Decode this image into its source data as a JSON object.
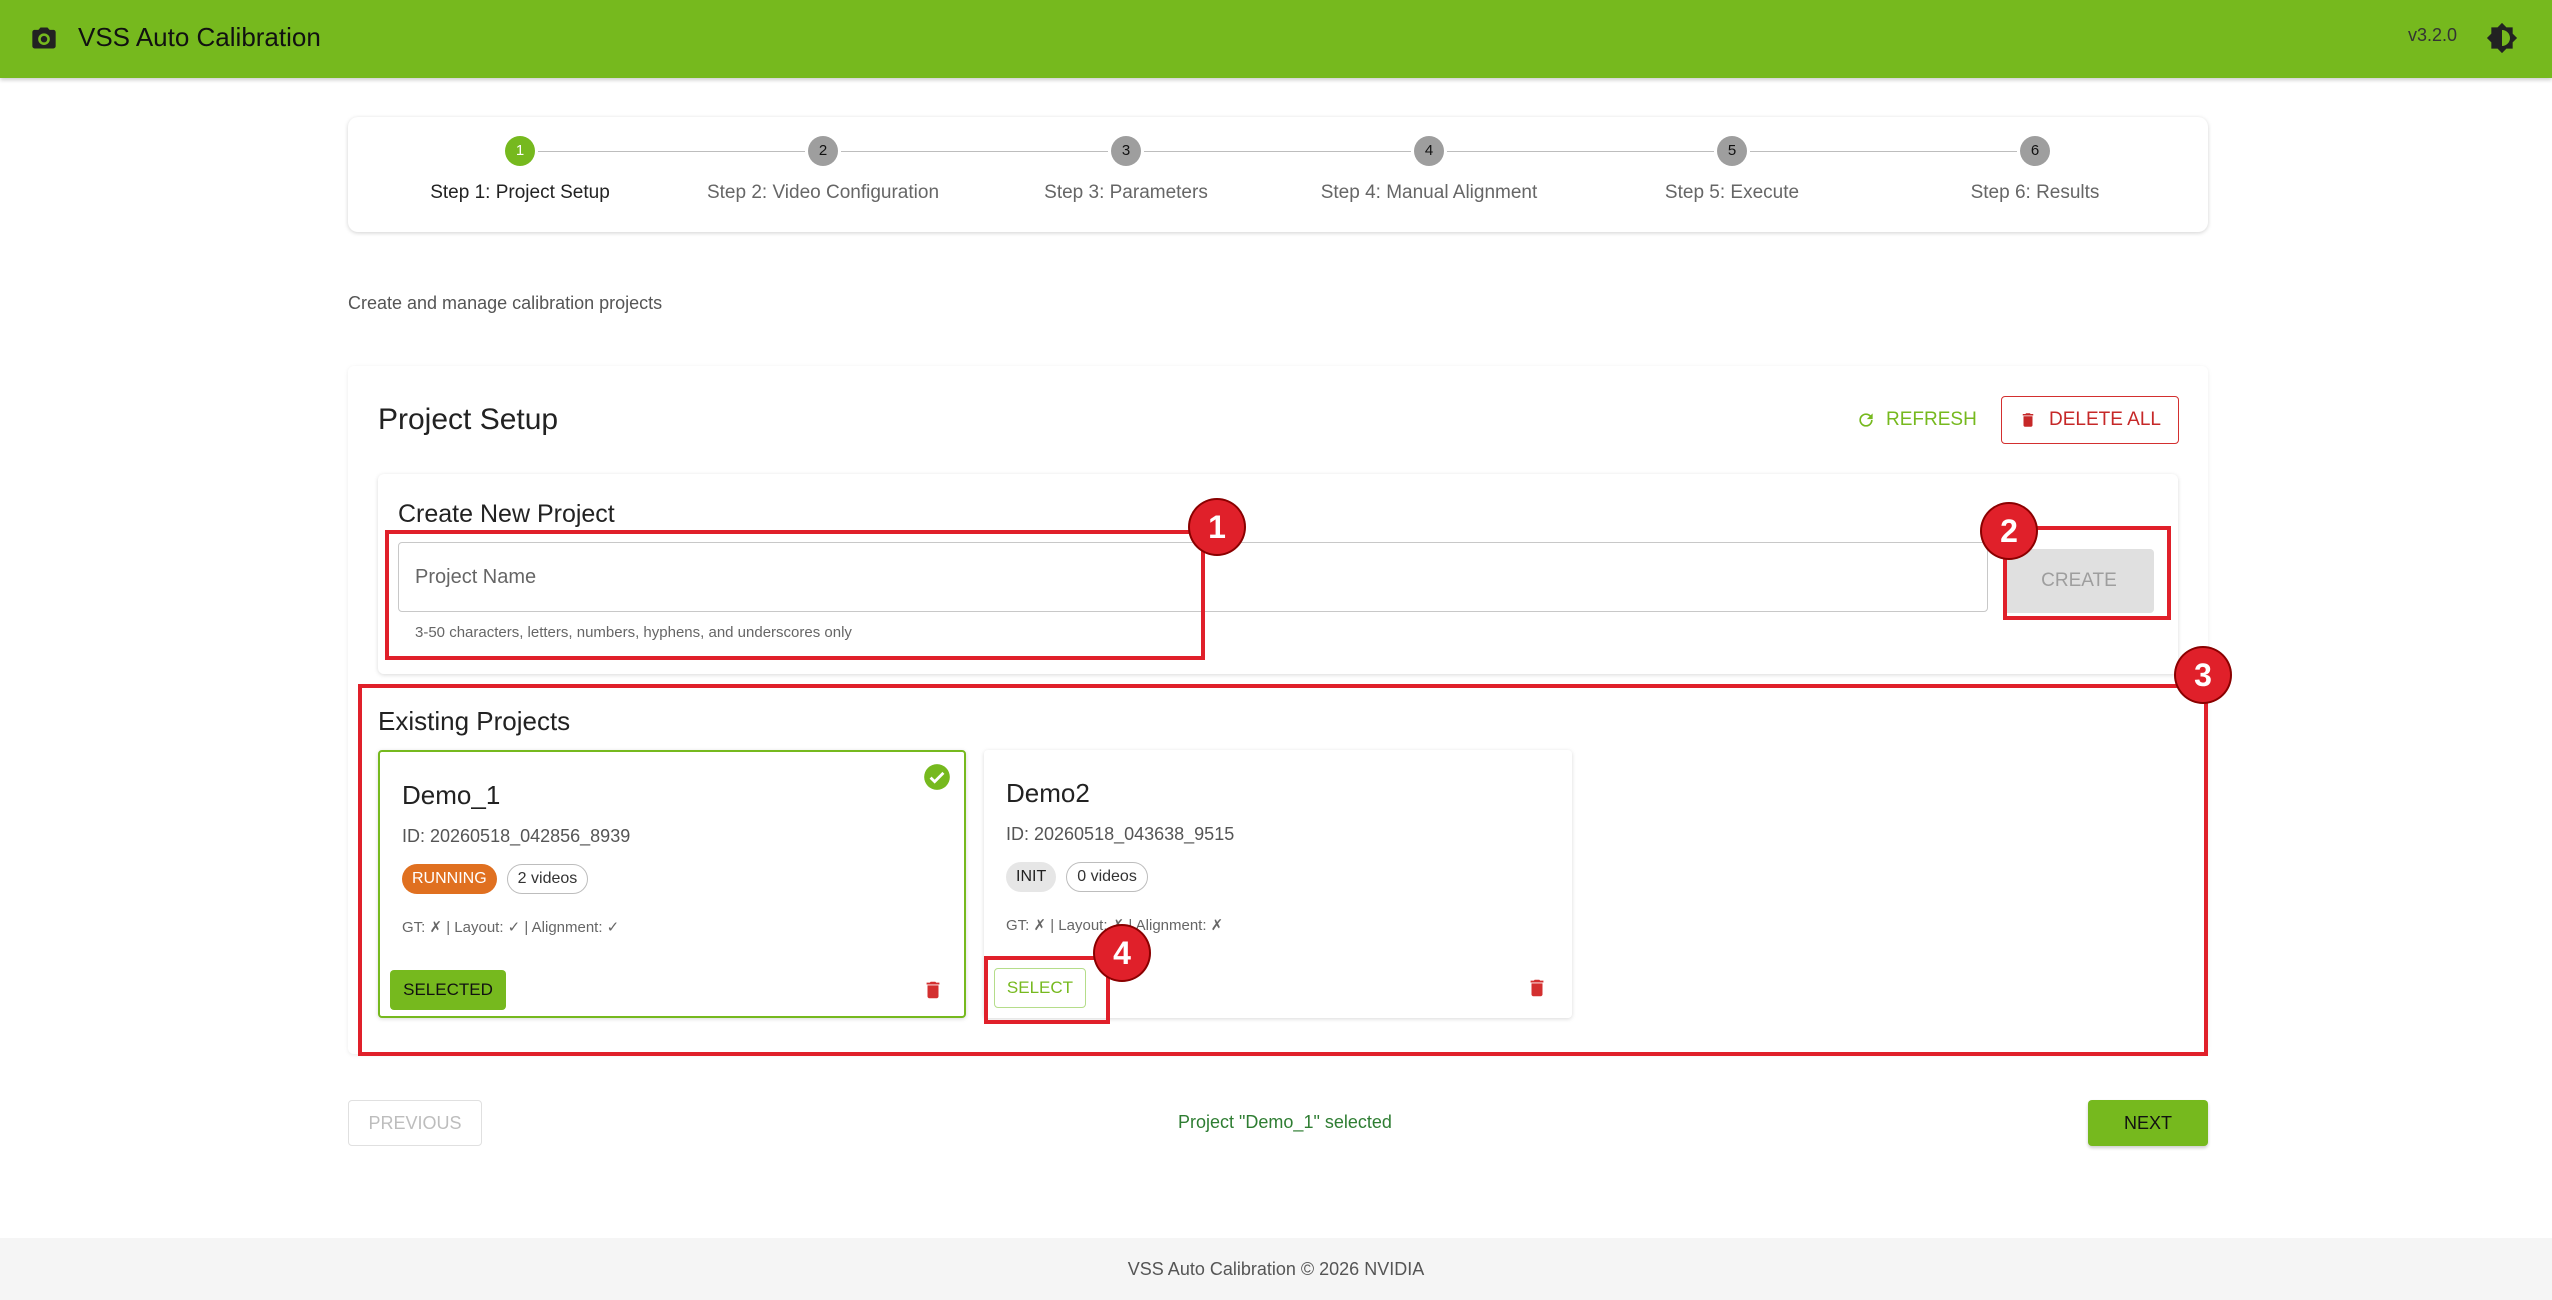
{
  "app": {
    "title": "VSS Auto Calibration",
    "version": "v3.2.0",
    "camera_icon": "camera-icon",
    "theme_icon": "brightness-icon"
  },
  "stepper": {
    "steps": [
      {
        "number": "1",
        "label": "Step 1: Project Setup",
        "active": true
      },
      {
        "number": "2",
        "label": "Step 2: Video Configuration"
      },
      {
        "number": "3",
        "label": "Step 3: Parameters"
      },
      {
        "number": "4",
        "label": "Step 4: Manual Alignment"
      },
      {
        "number": "5",
        "label": "Step 5: Execute"
      },
      {
        "number": "6",
        "label": "Step 6: Results"
      }
    ]
  },
  "page": {
    "subtitle": "Create and manage calibration projects"
  },
  "setup": {
    "title": "Project Setup",
    "refresh_label": "REFRESH",
    "delete_all_label": "DELETE ALL",
    "create": {
      "title": "Create New Project",
      "placeholder": "Project Name",
      "value": "",
      "helper": "3-50 characters, letters, numbers, hyphens, and underscores only",
      "create_label": "CREATE"
    },
    "existing": {
      "title": "Existing Projects",
      "projects": [
        {
          "name": "Demo_1",
          "id": "ID: 20260518_042856_8939",
          "status": "RUNNING",
          "videos": "2 videos",
          "flags": "GT: ✗ | Layout: ✓ | Alignment: ✓",
          "button": "SELECTED",
          "selected": true
        },
        {
          "name": "Demo2",
          "id": "ID: 20260518_043638_9515",
          "status": "INIT",
          "videos": "0 videos",
          "flags": "GT: ✗ | Layout: ✗ | Alignment: ✗",
          "button": "SELECT",
          "selected": false
        }
      ]
    }
  },
  "nav": {
    "previous_label": "PREVIOUS",
    "next_label": "NEXT",
    "status": "Project \"Demo_1\" selected"
  },
  "footer": {
    "text": "VSS Auto Calibration © 2026 NVIDIA"
  },
  "annotations": [
    "1",
    "2",
    "3",
    "4"
  ],
  "colors": {
    "primary": "#76b91e",
    "danger": "#d32f2f",
    "running": "#e07020",
    "highlight": "#e0202a"
  }
}
